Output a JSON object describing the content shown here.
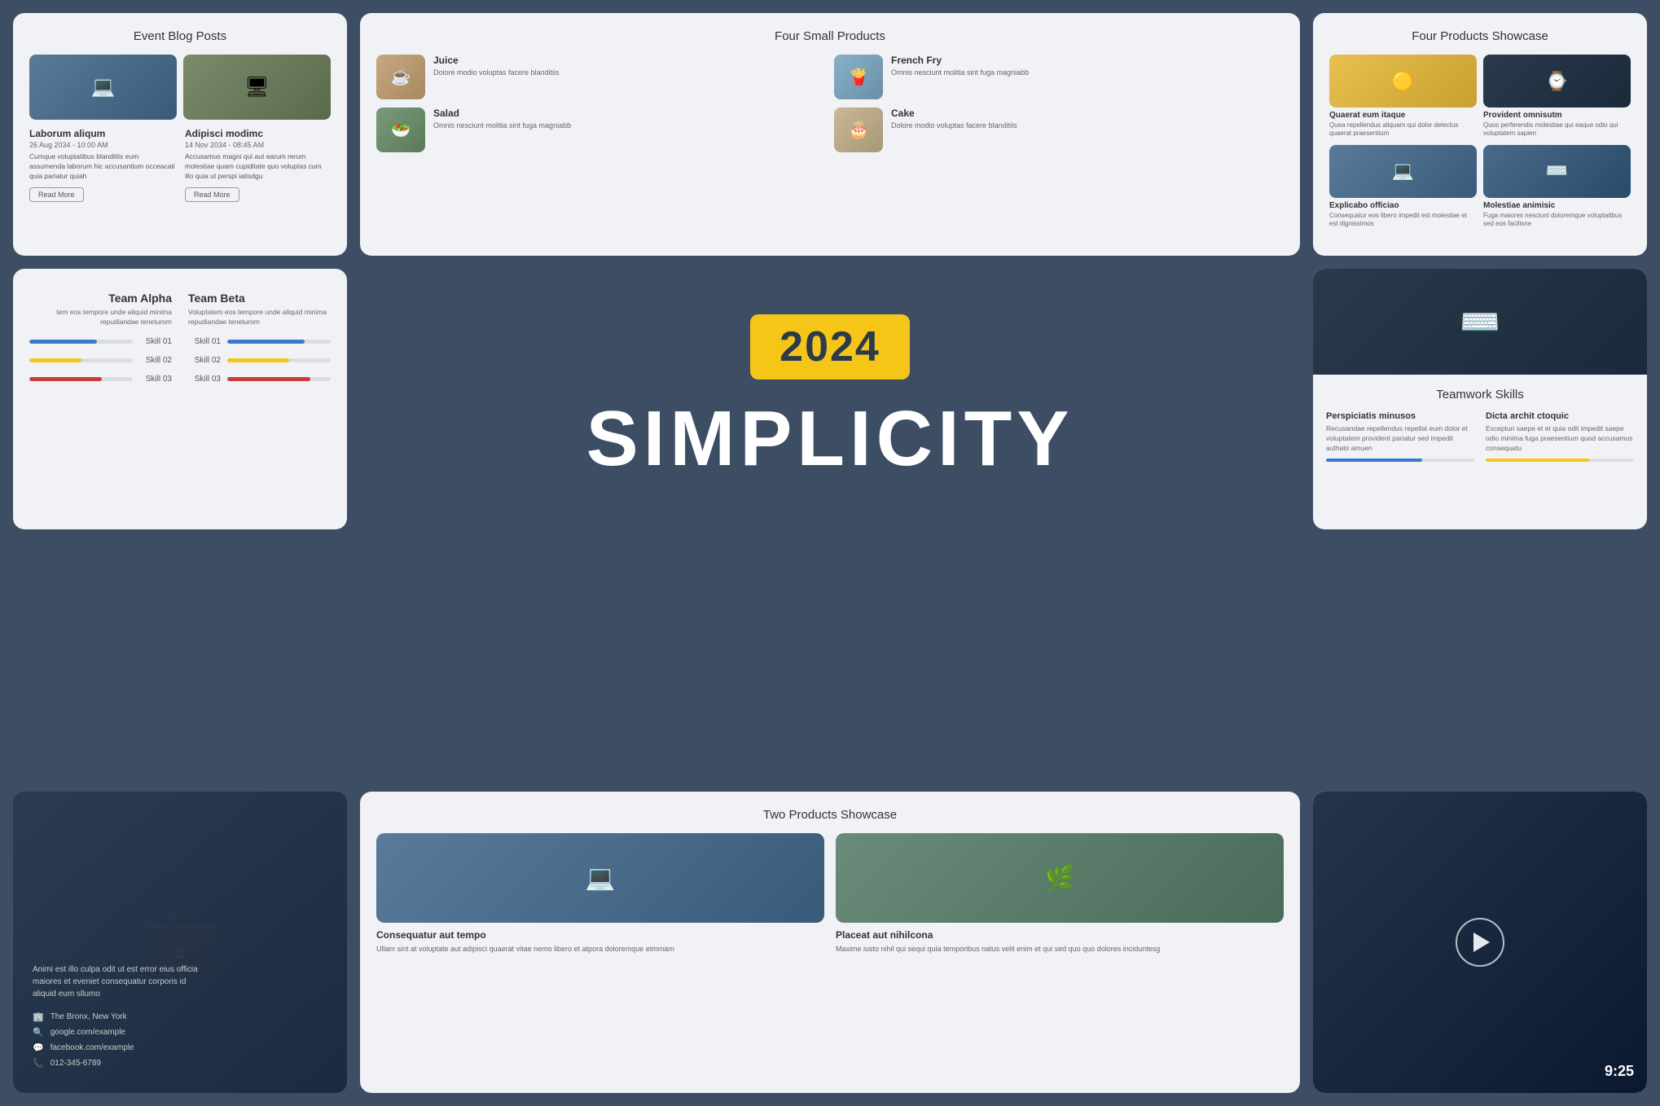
{
  "hero": {
    "year": "2024",
    "title": "SIMPLICITY"
  },
  "blog": {
    "section_title": "Event Blog Posts",
    "posts": [
      {
        "title": "Laborum aliqum",
        "date": "26 Aug 2034 - 10:00 AM",
        "text": "Cumque voluptatibus blanditiis eum assumenda laborum hic accusantium occeacati quia pariatur quiah",
        "button": "Read More"
      },
      {
        "title": "Adipisci modimc",
        "date": "14 Nov 2034 - 08:45 AM",
        "text": "Accusamus magni qui aut earum rerum molestiae quam cupiditate quo voluptas cum illo quia ut perspi iatisdgu",
        "button": "Read More"
      }
    ]
  },
  "four_products": {
    "section_title": "Four Small Products",
    "items": [
      {
        "name": "Juice",
        "desc": "Dolore modio voluptas facere blanditiis"
      },
      {
        "name": "French Fry",
        "desc": "Omnis nesciunt molitia sint fuga magniabb"
      },
      {
        "name": "Salad",
        "desc": "Omnis nesciunt molitia sint fuga magniabb"
      },
      {
        "name": "Cake",
        "desc": "Dolore modio voluptas facere blanditiis"
      }
    ]
  },
  "four_showcase": {
    "section_title": "Four Products Showcase",
    "items": [
      {
        "name": "Quaerat eum itaque",
        "desc": "Quea repellendus aliquam qui dolor delectus quaerat praesentium"
      },
      {
        "name": "Provident omnisutm",
        "desc": "Quos perferendis molestiae qui eaque odio qui voluptatem sapien"
      },
      {
        "name": "Explicabo officiao",
        "desc": "Consequatur eos libero impedit est molestiae et est dignissimos"
      },
      {
        "name": "Molestiae animisic",
        "desc": "Fuga maiores nesciunt doloremque voluptatibus sed eos facilisne"
      }
    ]
  },
  "skills": {
    "team_alpha": "Team Alpha",
    "team_beta": "Team Beta",
    "desc_alpha": "tem eos tempore unde aliquid minima repudiandae teneturom",
    "desc_beta": "Voluptatem eos tempore unde aliquid minima repudiandae teneturom",
    "skills": [
      {
        "label": "Skill 01",
        "alpha_pct": 65,
        "beta_pct": 75
      },
      {
        "label": "Skill 02",
        "alpha_pct": 50,
        "beta_pct": 60
      },
      {
        "label": "Skill 03",
        "alpha_pct": 70,
        "beta_pct": 80
      }
    ],
    "bar_colors": [
      "#3a7acc",
      "#f5c518",
      "#cc3a3a"
    ]
  },
  "teamwork": {
    "section_title": "Teamwork Skills",
    "items": [
      {
        "name": "Perspiciatis minusos",
        "desc": "Recusandae repellendus repellat eum dolor et voluptatem provident pariatur sed impedit authato amuen",
        "bar_color": "#3a7acc",
        "bar_pct": 65
      },
      {
        "name": "Dicta archit ctoquic",
        "desc": "Excepturi saepe et et quia odit impedit saepe odio minima fuga praesentium quod accusamus consequatu",
        "bar_color": "#f5c518",
        "bar_pct": 70
      }
    ]
  },
  "contact": {
    "desc": "Animi est illo culpa odit ut est error eius officia maiores et eveniet consequatur corporis id aliquid eum sllumo",
    "location": "The Bronx, New York",
    "website": "google.com/example",
    "facebook": "facebook.com/example",
    "phone": "012-345-6789"
  },
  "two_products": {
    "section_title": "Two Products Showcase",
    "items": [
      {
        "name": "Consequatur aut tempo",
        "desc": "Ullam sint at voluptate aut adipisci quaerat vitae nemo libero et atpora doloremque etmmam"
      },
      {
        "name": "Placeat aut nihilcona",
        "desc": "Maxime iusto nihil qui sequi quia temporibus natus velit enim et qui sed quo quo dolores inciduntesg"
      }
    ]
  }
}
